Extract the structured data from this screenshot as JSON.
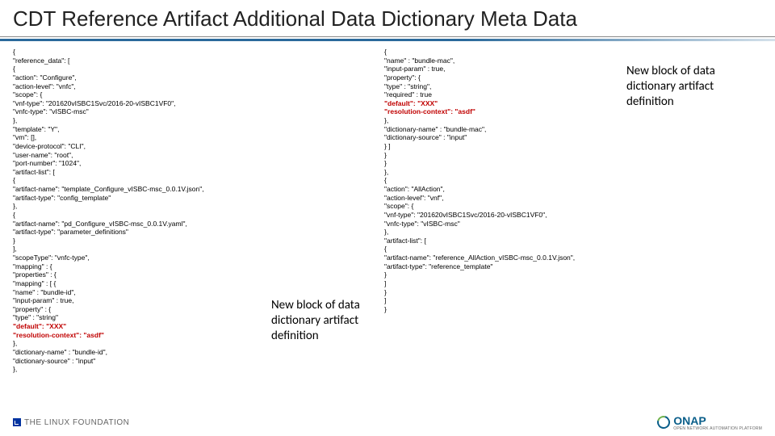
{
  "title": "CDT Reference Artifact Additional Data Dictionary Meta Data",
  "callout_left": "New block of data dictionary artifact definition",
  "callout_right": "New block of data dictionary artifact definition",
  "code_left": [
    "{",
    "\"reference_data\": [",
    "{",
    "\"action\": \"Configure\",",
    "\"action-level\": \"vnfc\",",
    "\"scope\": {",
    "\"vnf-type\": \"201620vISBC1Svc/2016-20-vISBC1VF0\",",
    "\"vnfc-type\": \"vISBC-msc\"",
    "},",
    "\"template\": \"Y\",",
    "\"vm\": [],",
    "\"device-protocol\": \"CLI\",",
    "\"user-name\": \"root\",",
    "\"port-number\": \"1024\",",
    "\"artifact-list\": [",
    "{",
    "\"artifact-name\": \"template_Configure_vISBC-msc_0.0.1V.json\",",
    "\"artifact-type\": \"config_template\"",
    "},",
    "{",
    "\"artifact-name\": \"pd_Configure_vISBC-msc_0.0.1V.yaml\",",
    "\"artifact-type\": \"parameter_definitions\"",
    "}",
    "],",
    "\"scopeType\": \"vnfc-type\",",
    "\"mapping\" : {",
    "\"properties\" : {",
    "\"mapping\" : [ {",
    "\"name\" : \"bundle-id\",",
    "\"input-param\" : true,",
    "\"property\" : {",
    "\"type\" : \"string\"",
    {
      "text": "\"default\": \"XXX\"",
      "red": true
    },
    {
      "text": "\"resolution-context\": \"asdf\"",
      "red": true
    },
    "},",
    "\"dictionary-name\" : \"bundle-id\",",
    "\"dictionary-source\" : \"input\"",
    "},"
  ],
  "code_right": [
    "{",
    "\"name\" : \"bundle-mac\",",
    "\"input-param\" : true,",
    "\"property\": {",
    "\"type\" : \"string\",",
    "\"required\" : true",
    {
      "text": "\"default\": \"XXX\"",
      "red": true
    },
    {
      "text": "\"resolution-context\": \"asdf\"",
      "red": true
    },
    "},",
    "\"dictionary-name\" : \"bundle-mac\",",
    "\"dictionary-source\" : \"input\"",
    "} ]",
    "}",
    "}",
    "},",
    "{",
    "\"action\": \"AllAction\",",
    "\"action-level\": \"vnf\",",
    "\"scope\": {",
    "\"vnf-type\": \"201620vISBC1Svc/2016-20-vISBC1VF0\",",
    "\"vnfc-type\": \"vISBC-msc\"",
    "},",
    "\"artifact-list\": [",
    "{",
    "\"artifact-name\": \"reference_AllAction_vISBC-msc_0.0.1V.json\",",
    "\"artifact-type\": \"reference_template\"",
    "}",
    "]",
    "}",
    "]",
    "}"
  ],
  "footer": {
    "linux": "THE LINUX FOUNDATION",
    "onap": "ONAP",
    "onap_sub": "OPEN NETWORK AUTOMATION PLATFORM"
  }
}
